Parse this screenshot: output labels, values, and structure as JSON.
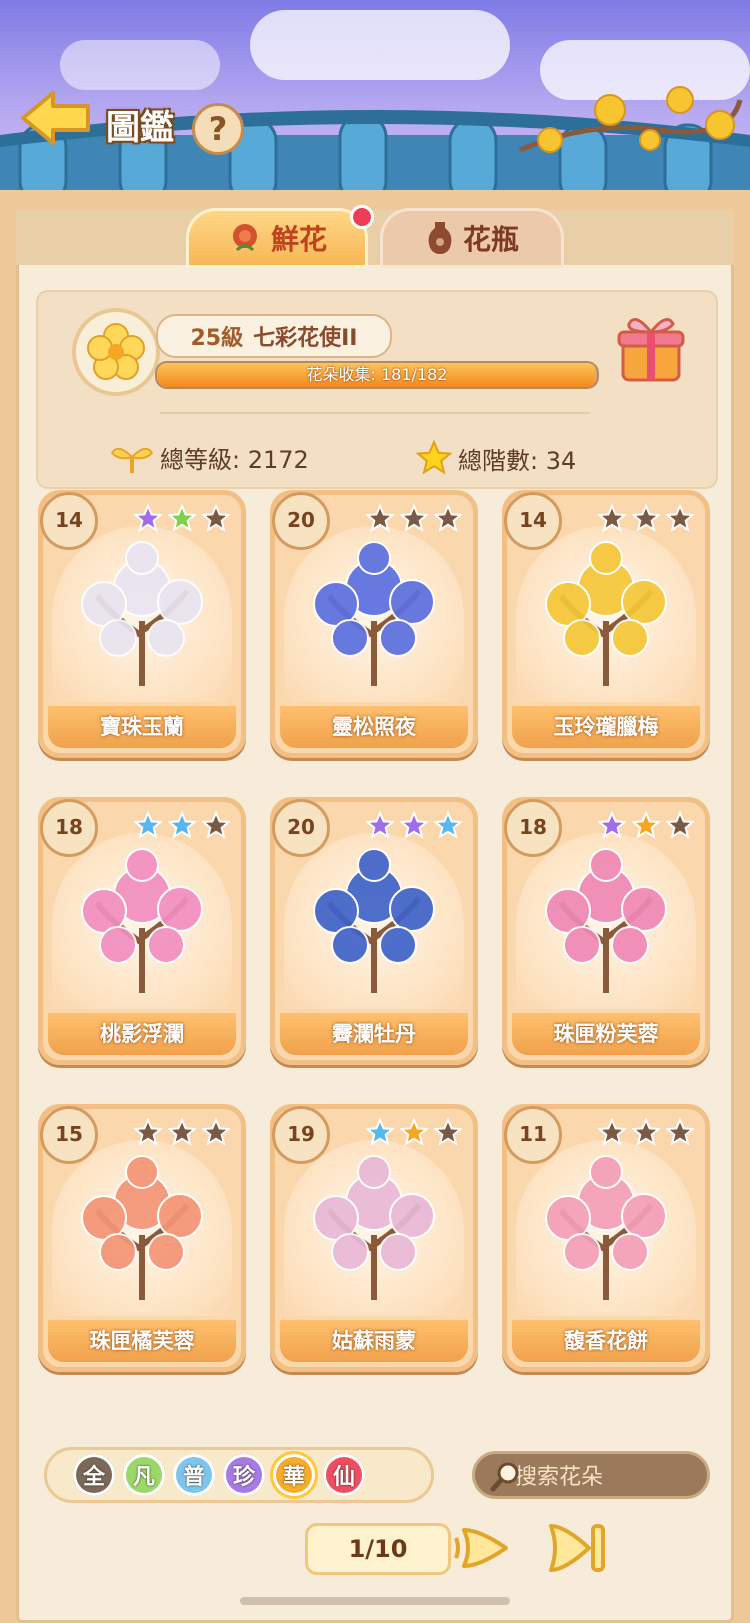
{
  "header": {
    "title": "圖鑑",
    "help": "?"
  },
  "tabs": [
    {
      "label": "鮮花",
      "active": true
    },
    {
      "label": "花瓶",
      "active": false
    }
  ],
  "summary": {
    "level": "25級",
    "rank": "七彩花使II",
    "collection_text": "花朵收集: 181/182",
    "collection_progress": 0.9945,
    "total_level_label": "總等級: 2172",
    "total_stars_label": "總階數: 34"
  },
  "cards": [
    {
      "level": "14",
      "name": "寶珠玉蘭",
      "stars": [
        "#a06ee8",
        "#7fd14a",
        "#7a5a44"
      ],
      "art_color": "#e9e4f1"
    },
    {
      "level": "20",
      "name": "靈松照夜",
      "stars": [
        "#7a5a44",
        "#7a5a44",
        "#7a5a44"
      ],
      "art_color": "#5b6fe0"
    },
    {
      "level": "14",
      "name": "玉玲瓏臘梅",
      "stars": [
        "#7a5a44",
        "#7a5a44",
        "#7a5a44"
      ],
      "art_color": "#f5c738"
    },
    {
      "level": "18",
      "name": "桃影浮瀾",
      "stars": [
        "#57b8f0",
        "#57b8f0",
        "#7a5a44"
      ],
      "art_color": "#f28fc0"
    },
    {
      "level": "20",
      "name": "霽瀾牡丹",
      "stars": [
        "#a06ee8",
        "#a06ee8",
        "#57b8f0"
      ],
      "art_color": "#3f63c9"
    },
    {
      "level": "18",
      "name": "珠匣粉芙蓉",
      "stars": [
        "#a06ee8",
        "#f6a623",
        "#7a5a44"
      ],
      "art_color": "#ef88b5"
    },
    {
      "level": "15",
      "name": "珠匣橘芙蓉",
      "stars": [
        "#7a5a44",
        "#7a5a44",
        "#7a5a44"
      ],
      "art_color": "#f49576"
    },
    {
      "level": "19",
      "name": "姑蘇雨蒙",
      "stars": [
        "#57b8f0",
        "#f6a623",
        "#7a5a44"
      ],
      "art_color": "#e9b8d6"
    },
    {
      "level": "11",
      "name": "馥香花餅",
      "stars": [
        "#7a5a44",
        "#7a5a44",
        "#7a5a44"
      ],
      "art_color": "#f49fb8"
    }
  ],
  "filters": [
    {
      "label": "全",
      "color": "#7a6858"
    },
    {
      "label": "凡",
      "color": "#9ad86a"
    },
    {
      "label": "普",
      "color": "#7cc6ee"
    },
    {
      "label": "珍",
      "color": "#a77ae6"
    },
    {
      "label": "華",
      "color": "#f7ad2b"
    },
    {
      "label": "仙",
      "color": "#ec4e62"
    }
  ],
  "search": {
    "placeholder": "搜索花朵"
  },
  "pagination": {
    "text": "1/10"
  }
}
